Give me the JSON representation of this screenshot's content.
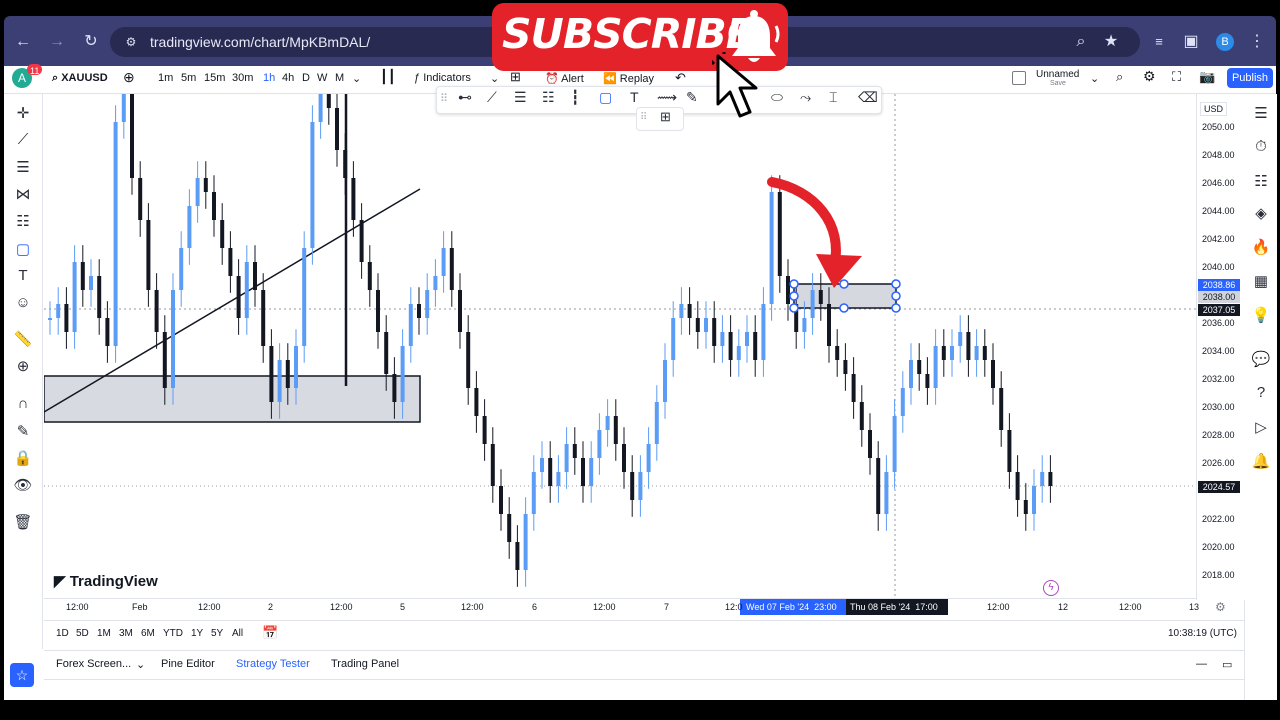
{
  "browser": {
    "url": "tradingview.com/chart/MpKBmDAL/",
    "profile_initial": "B"
  },
  "overlay": {
    "subscribe_label": "SUBSCRIBE"
  },
  "toolbar": {
    "avatar_letter": "A",
    "avatar_badge": "11",
    "symbol": "XAUUSD",
    "intervals": [
      "1m",
      "5m",
      "15m",
      "30m",
      "1h",
      "4h",
      "D",
      "W",
      "M"
    ],
    "active_interval": "1h",
    "indicators_label": "Indicators",
    "alert_label": "Alert",
    "replay_label": "Replay",
    "layout_name": "Unnamed",
    "layout_sub": "Save",
    "publish_label": "Publish"
  },
  "price_axis": {
    "currency": "USD",
    "labels": [
      "2050.00",
      "2048.00",
      "2046.00",
      "2044.00",
      "2042.00",
      "2040.00",
      "2036.00",
      "2034.00",
      "2032.00",
      "2030.00",
      "2028.00",
      "2026.00",
      "2022.00",
      "2020.00",
      "2018.00"
    ],
    "tag_top": "2038.86",
    "tag_mid": "2038.00",
    "tag_current": "2037.05",
    "tag_last": "2024.57"
  },
  "time_axis": {
    "labels": [
      "12:00",
      "Feb",
      "12:00",
      "2",
      "12:00",
      "5",
      "12:00",
      "6",
      "12:00",
      "7",
      "12:0",
      "12:00",
      "12",
      "12:00",
      "13"
    ],
    "range_start": "Wed 07 Feb '24",
    "range_start_time": "23:00",
    "range_end": "Thu 08 Feb '24",
    "range_end_time": "17:00"
  },
  "range_bar": {
    "ranges": [
      "1D",
      "5D",
      "1M",
      "3M",
      "6M",
      "YTD",
      "1Y",
      "5Y",
      "All"
    ],
    "clock": "10:38:19 (UTC)"
  },
  "bottom_panel": {
    "tabs": [
      "Forex Screen...",
      "Pine Editor",
      "Strategy Tester",
      "Trading Panel"
    ],
    "active_tab": "Strategy Tester"
  },
  "brand": {
    "logo_text": "TradingView"
  },
  "colors": {
    "accent": "#2962ff",
    "bull": "#5b9cf6",
    "bear": "#131722",
    "subscribe": "#e32229"
  }
}
